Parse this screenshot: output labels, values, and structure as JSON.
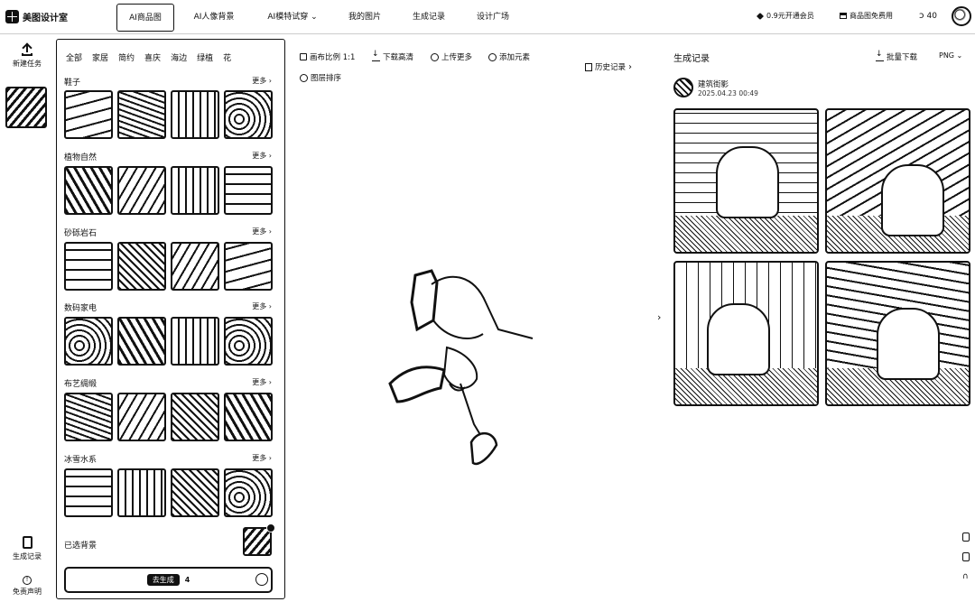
{
  "app": {
    "name": "美图设计室"
  },
  "nav": {
    "tabs": [
      {
        "label": "AI商品图"
      },
      {
        "label": "AI人像背景"
      },
      {
        "label": "AI模特试穿 ⌄"
      },
      {
        "label": "我的图片"
      },
      {
        "label": "生成记录"
      },
      {
        "label": "设计广场"
      }
    ],
    "vip": "0.9元开通会员",
    "shop_free": "商品图免费用",
    "credits": "40"
  },
  "rail": {
    "new_task": "新建任务",
    "history": "生成记录",
    "free_notice": "免责声明"
  },
  "panel": {
    "categories": [
      "全部",
      "家居",
      "简约",
      "喜庆",
      "海边",
      "绿植",
      "花"
    ],
    "more_label": "更多",
    "sections": [
      {
        "title": "鞋子"
      },
      {
        "title": "植物自然"
      },
      {
        "title": "砂砾岩石"
      },
      {
        "title": "数码家电"
      },
      {
        "title": "布艺绸缎"
      },
      {
        "title": "冰雪水系"
      }
    ],
    "applied_label": "已选背景",
    "generate_label": "去生成",
    "generate_cost": "4"
  },
  "toolbar": {
    "aspect": "画布比例 1:1",
    "download_hd": "下载高清",
    "upload_more": "上传更多",
    "add_element": "添加元素",
    "layer_order": "图层排序",
    "history": "历史记录"
  },
  "results": {
    "title": "生成记录",
    "batch_download": "批量下载",
    "format": "PNG ⌄",
    "record_name": "建筑街影",
    "record_time": "2025.04.23 00:49"
  }
}
